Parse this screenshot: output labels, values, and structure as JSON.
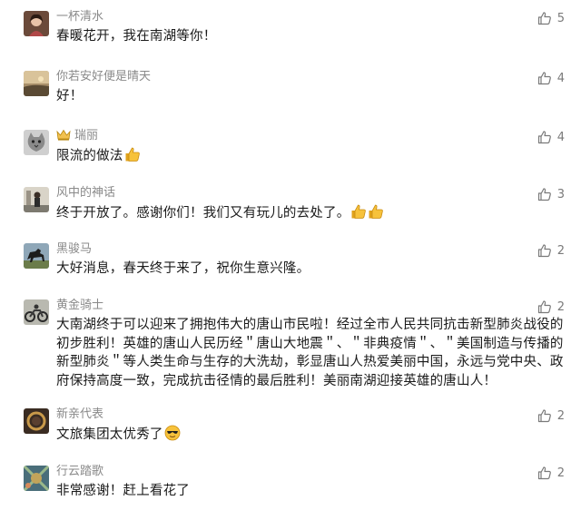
{
  "comments": [
    {
      "user": "一杯清水",
      "text": "春暖花开，我在南湖等你！",
      "likes": "5",
      "avatar": "avatar-woman"
    },
    {
      "user": "你若安好便是晴天",
      "text": "好！",
      "likes": "4",
      "avatar": "avatar-sunset"
    },
    {
      "user": "瑞丽",
      "text": "限流的做法",
      "likes": "4",
      "avatar": "avatar-cat",
      "badge": "crown-icon",
      "emoji": "thumbs-up"
    },
    {
      "user": "风中的神话",
      "text": "终于开放了。感谢你们！我们又有玩儿的去处了。",
      "likes": "3",
      "avatar": "avatar-person",
      "emoji": "two-thumbs-up"
    },
    {
      "user": "黑骏马",
      "text": "大好消息，春天终于来了，祝你生意兴隆。",
      "likes": "2",
      "avatar": "avatar-horse"
    },
    {
      "user": "黄金骑士",
      "text": "大南湖终于可以迎来了拥抱伟大的唐山市民啦！经过全市人民共同抗击新型肺炎战役的初步胜利！英雄的唐山人民历经＂唐山大地震＂、＂非典疫情＂、＂美国制造与传播的新型肺炎＂等人类生命与生存的大洗劫，彰显唐山人热爱美丽中国，永远与党中央、政府保持高度一致，完成抗击径情的最后胜利！美丽南湖迎接英雄的唐山人！",
      "likes": "2",
      "avatar": "avatar-motorbike"
    },
    {
      "user": "新亲代表",
      "text": "文旅集团太优秀了",
      "likes": "2",
      "avatar": "avatar-ring",
      "emoji": "sunglasses-face"
    },
    {
      "user": "行云踏歌",
      "text": "非常感谢！赶上看花了",
      "likes": "2",
      "avatar": "avatar-pattern"
    }
  ]
}
